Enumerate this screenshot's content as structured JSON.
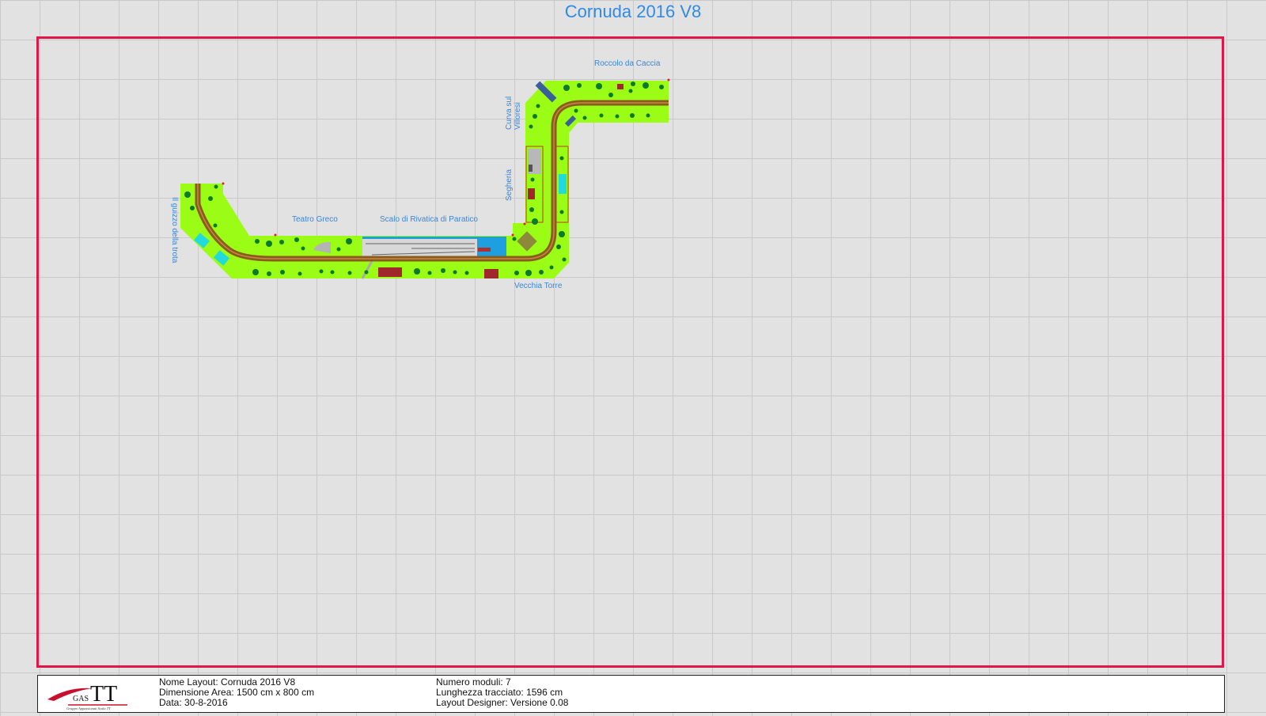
{
  "title": "Cornuda 2016 V8",
  "modules": {
    "labels": {
      "guizzo": "Il guizzo della trota",
      "teatro": "Teatro Greco",
      "scalo": "Scalo di Rivatica di Paratico",
      "torre": "Vecchia Torre",
      "segheria": "Segheria",
      "curva_line1": "Curva sul",
      "curva_line2": "Villoresi",
      "roccolo": "Roccolo da Caccia"
    }
  },
  "colors": {
    "border": "#dd1748",
    "grass": "#9bfc15",
    "track": "#8a5a1e",
    "water": "#1ea0e0",
    "label": "#3a86d6",
    "title": "#2f8ae8"
  },
  "footer": {
    "logo_text": "TT",
    "logo_prefix": "GAS",
    "logo_subtitle": "Gruppo Appassionati Scala TT",
    "nome_layout": "Nome Layout: Cornuda 2016 V8",
    "dimensione": "Dimensione Area: 1500 cm x 800 cm",
    "data": "Data: 30-8-2016",
    "numero_moduli": "Numero moduli: 7",
    "lunghezza": "Lunghezza tracciato: 1596 cm",
    "designer": "Layout Designer: Versione 0.08"
  }
}
